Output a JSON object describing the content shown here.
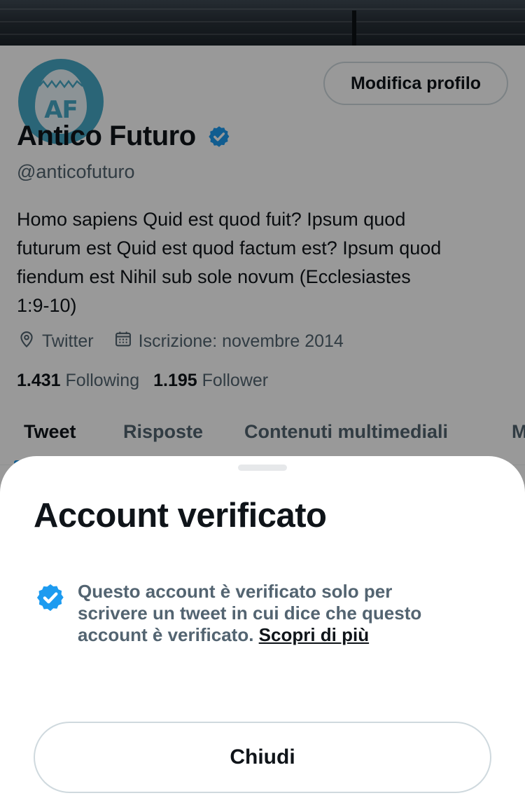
{
  "profile": {
    "avatar_text": "AF",
    "edit_button": "Modifica profilo",
    "name": "Antico Futuro",
    "handle": "@anticofuturo",
    "bio_lines": [
      "Homo sapiens Quid est quod fuit? Ipsum quod",
      "futurum est Quid est quod factum est? Ipsum quod",
      "fiendum est Nihil sub sole novum (Ecclesiastes",
      "1:9-10)"
    ],
    "location": "Twitter",
    "joined": "Iscrizione: novembre 2014",
    "following_count": "1.431",
    "following_label": "Following",
    "follower_count": "1.195",
    "follower_label": "Follower"
  },
  "tabs": [
    {
      "label": "Tweet",
      "active": true
    },
    {
      "label": "Risposte",
      "active": false
    },
    {
      "label": "Contenuti multimediali",
      "active": false
    },
    {
      "label": "M",
      "active": false
    }
  ],
  "sheet": {
    "title": "Account verificato",
    "text_lines": [
      "Questo account è verificato solo per",
      "scrivere un tweet in cui dice che questo",
      "account è verificato."
    ],
    "link": "Scopri di più",
    "close_button": "Chiudi"
  },
  "colors": {
    "accent": "#1d9bf0",
    "avatar_bg": "#47a9c6",
    "text_primary": "#0f1419",
    "text_secondary": "#536471",
    "border": "#cfd9de"
  },
  "icons": {
    "verified": "verified-badge-icon",
    "location": "location-pin-icon",
    "calendar": "calendar-icon"
  }
}
